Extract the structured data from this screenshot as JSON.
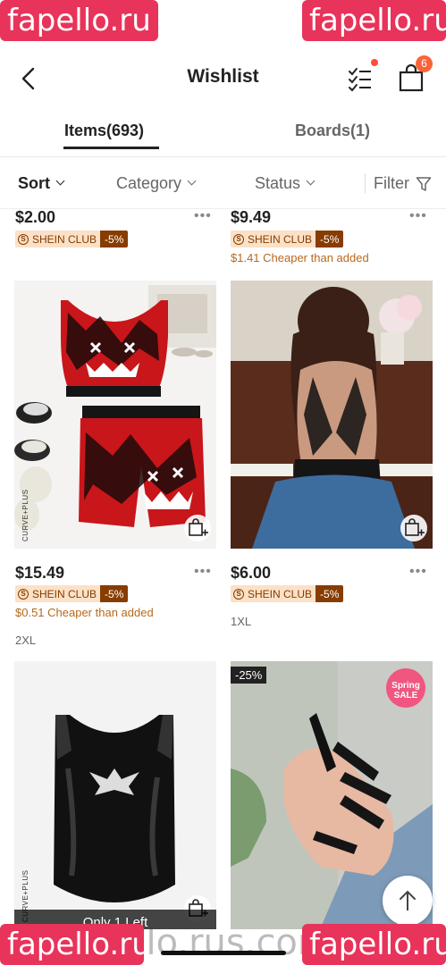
{
  "header": {
    "title": "Wishlist",
    "bag_count": "6"
  },
  "tabs": [
    {
      "label": "Items(693)"
    },
    {
      "label": "Boards(1)"
    }
  ],
  "filters": {
    "sort": "Sort",
    "category": "Category",
    "status": "Status",
    "filter": "Filter"
  },
  "products": [
    {
      "price": "$2.00",
      "club_label": "SHEIN CLUB",
      "club_discount": "-5%"
    },
    {
      "price": "$9.49",
      "club_label": "SHEIN CLUB",
      "club_discount": "-5%",
      "cheaper": "$1.41 Cheaper than added"
    },
    {
      "price": "$15.49",
      "club_label": "SHEIN CLUB",
      "club_discount": "-5%",
      "cheaper": "$0.51 Cheaper than added",
      "size": "2XL",
      "brand": "CURVE+PLUS"
    },
    {
      "price": "$6.00",
      "club_label": "SHEIN CLUB",
      "club_discount": "-5%",
      "size": "1XL"
    },
    {
      "brand": "CURVE+PLUS",
      "stock": "Only 1 Left"
    },
    {
      "discount": "-25%",
      "promo": "Spring SALE"
    }
  ],
  "watermark": {
    "text": "fapello.ru",
    "url": "fapello.rus.com/au"
  },
  "colors": {
    "accent": "#fa6338",
    "club_dark": "#873c00",
    "club_light": "#fbe1c7",
    "cheaper": "#b8681e",
    "watermark": "#e8335a"
  }
}
